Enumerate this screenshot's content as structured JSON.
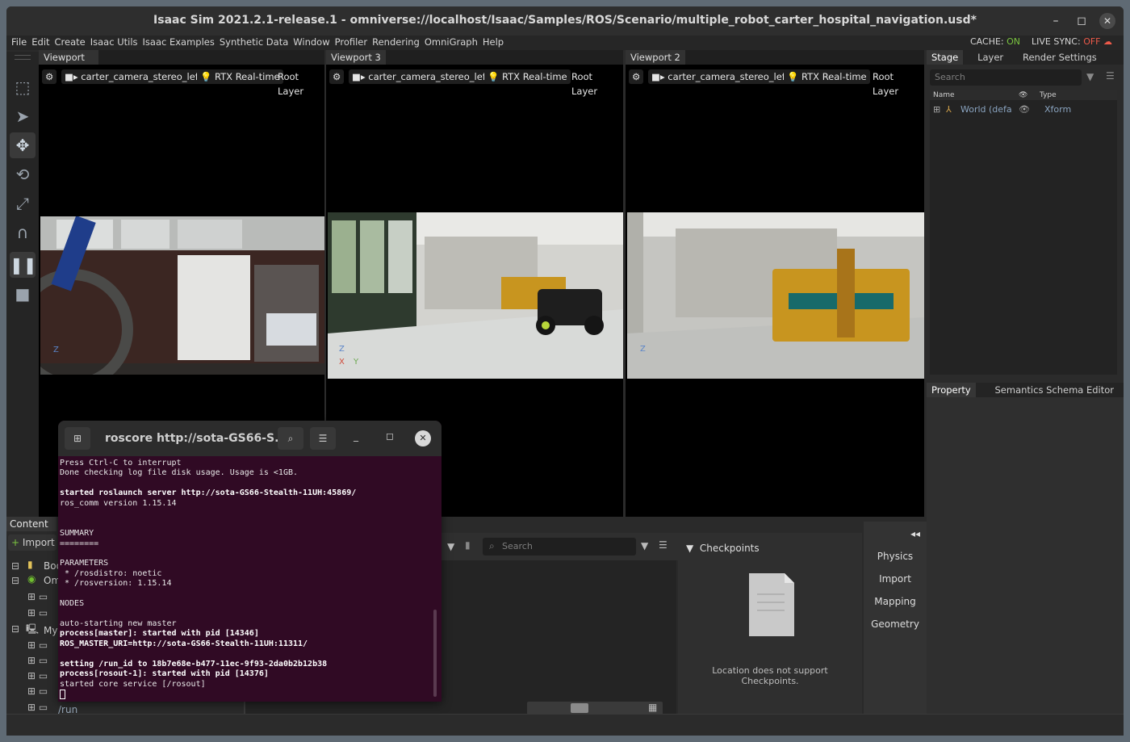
{
  "window": {
    "title": "Isaac Sim 2021.2.1-release.1 - omniverse://localhost/Isaac/Samples/ROS/Scenario/multiple_robot_carter_hospital_navigation.usd*",
    "minimize": "–",
    "maximize": "◻",
    "close": "✕"
  },
  "menu": [
    "File",
    "Edit",
    "Create",
    "Isaac Utils",
    "Isaac Examples",
    "Synthetic Data",
    "Window",
    "Profiler",
    "Rendering",
    "OmniGraph",
    "Help"
  ],
  "status": {
    "cache_label": "CACHE:",
    "cache_value": "ON",
    "live_label": "LIVE SYNC:",
    "live_value": "OFF"
  },
  "viewports": [
    {
      "tab": "Viewport",
      "camera": "carter_camera_stereo_left",
      "render": "RTX Real-time",
      "layer": "Root Layer"
    },
    {
      "tab": "Viewport 3",
      "camera": "carter_camera_stereo_left",
      "render": "RTX Real-time",
      "layer": "Root Layer"
    },
    {
      "tab": "Viewport 2",
      "camera": "carter_camera_stereo_left",
      "render": "RTX Real-time",
      "layer": "Root Layer"
    }
  ],
  "axis": {
    "z": "Z",
    "y": "Y",
    "x": "X"
  },
  "stage": {
    "tabs": [
      "Stage",
      "Layer",
      "Render Settings"
    ],
    "search_placeholder": "Search",
    "columns": [
      "Name",
      "Type"
    ],
    "rows": [
      {
        "name": "World (defa",
        "type": "Xform"
      }
    ]
  },
  "property": {
    "tabs": [
      "Property",
      "Semantics Schema Editor"
    ]
  },
  "content": {
    "tab": "Content",
    "import": "Import",
    "tree": [
      "Boo",
      "Om",
      "",
      "",
      "My",
      "",
      "",
      "",
      "",
      "/run"
    ],
    "search_placeholder": "Search",
    "checkpoints_title": "Checkpoints",
    "checkpoints_msg1": "Location does not support",
    "checkpoints_msg2": "Checkpoints.",
    "side_buttons": [
      "Physics",
      "Import",
      "Mapping",
      "Geometry"
    ]
  },
  "terminal": {
    "title": "roscore http://sota-GS66-S...",
    "lines": [
      {
        "t": "Press Ctrl-C to interrupt",
        "b": false
      },
      {
        "t": "Done checking log file disk usage. Usage is <1GB.",
        "b": false
      },
      {
        "t": "",
        "b": false
      },
      {
        "t": "started roslaunch server http://sota-GS66-Stealth-11UH:45869/",
        "b": true
      },
      {
        "t": "ros_comm version 1.15.14",
        "b": false
      },
      {
        "t": "",
        "b": false
      },
      {
        "t": "",
        "b": false
      },
      {
        "t": "SUMMARY",
        "b": false
      },
      {
        "t": "========",
        "b": false
      },
      {
        "t": "",
        "b": false
      },
      {
        "t": "PARAMETERS",
        "b": false
      },
      {
        "t": " * /rosdistro: noetic",
        "b": false
      },
      {
        "t": " * /rosversion: 1.15.14",
        "b": false
      },
      {
        "t": "",
        "b": false
      },
      {
        "t": "NODES",
        "b": false
      },
      {
        "t": "",
        "b": false
      },
      {
        "t": "auto-starting new master",
        "b": false
      },
      {
        "t": "process[master]: started with pid [14346]",
        "b": true
      },
      {
        "t": "ROS_MASTER_URI=http://sota-GS66-Stealth-11UH:11311/",
        "b": true
      },
      {
        "t": "",
        "b": false
      },
      {
        "t": "setting /run_id to 18b7e68e-b477-11ec-9f93-2da0b2b12b38",
        "b": true
      },
      {
        "t": "process[rosout-1]: started with pid [14376]",
        "b": true
      },
      {
        "t": "started core service [/rosout]",
        "b": false
      }
    ]
  }
}
